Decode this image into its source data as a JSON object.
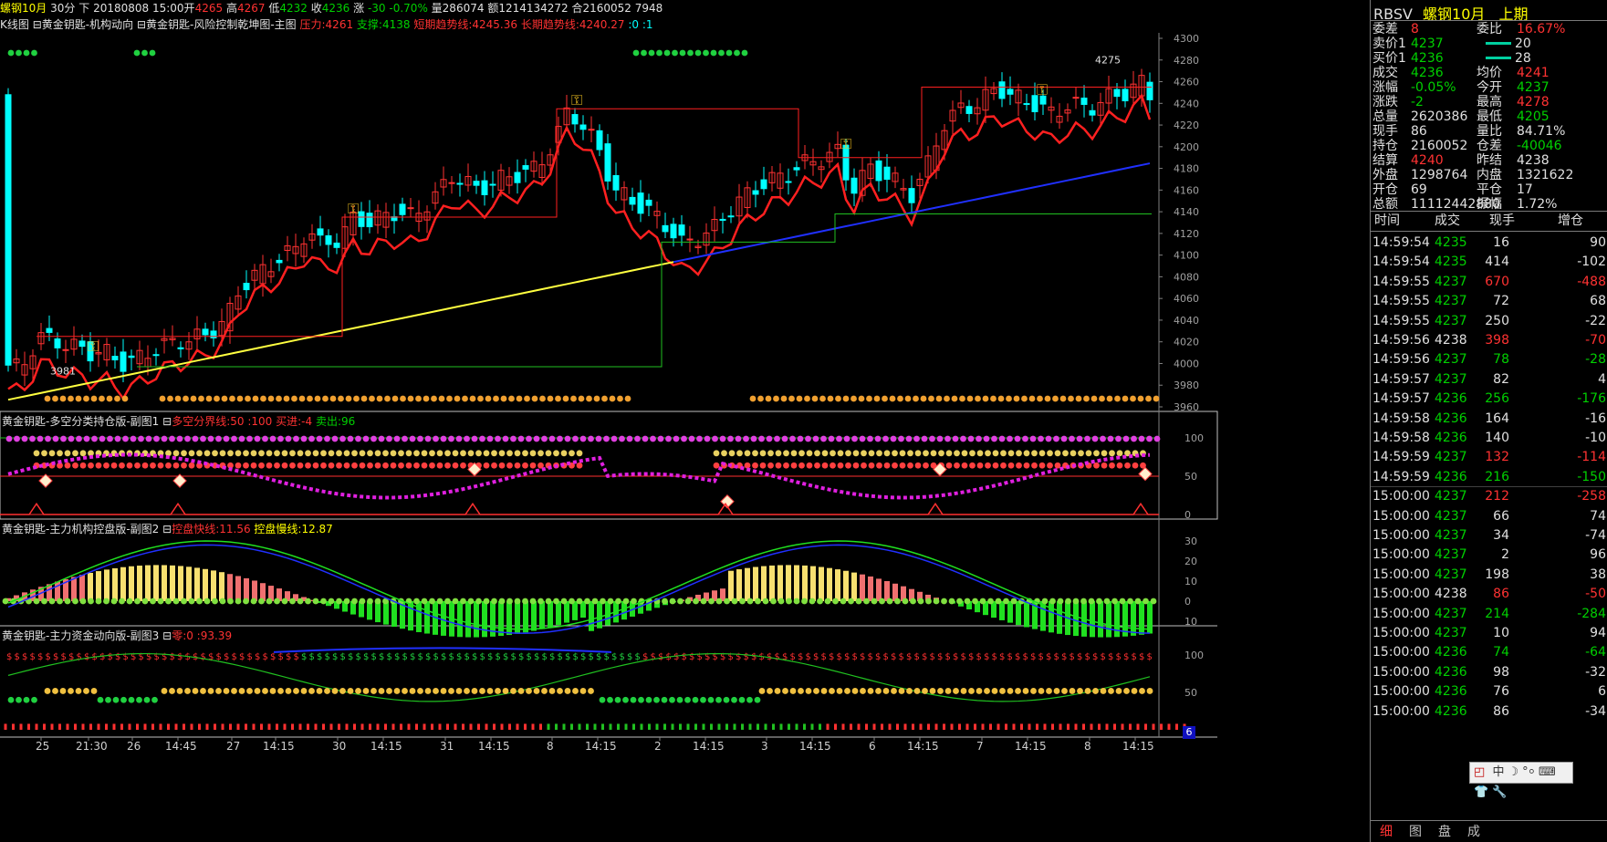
{
  "header": {
    "symbol": "螺钢10月",
    "period": "30分",
    "direction": "下",
    "date": "20180808 15:00",
    "open_label": "开",
    "open": "4265",
    "high_label": "高",
    "high": "4267",
    "low_label": "低",
    "low": "4232",
    "close_label": "收",
    "close": "4236",
    "change_label": "涨",
    "change": "-30",
    "change_pct": "-0.70%",
    "volume": "量286074",
    "amount": "额1214134272",
    "position": "合2160052 7948"
  },
  "main_pane": {
    "indicator_prefix": "K线图",
    "indicator1": "黄金钥匙-机构动向",
    "indicator2": "黄金钥匙-风险控制乾坤图-主图",
    "pressure": "压力:4261",
    "support": "支撑:4138",
    "short_trend": "短期趋势线:4245.36",
    "long_trend": "长期趋势线:4240.27",
    "extra": ":0 :1",
    "marker_3981": "3981",
    "marker_4275": "4275",
    "y_ticks": [
      "4300",
      "4280",
      "4260",
      "4240",
      "4220",
      "4200",
      "4180",
      "4160",
      "4140",
      "4120",
      "4100",
      "4080",
      "4060",
      "4040",
      "4020",
      "4000",
      "3980",
      "3960"
    ]
  },
  "sub1": {
    "title": "黄金钥匙-多空分类持仓版-副图1",
    "line1": "多空分界线:50 :100",
    "buy": "买进:-4",
    "sell": "卖出:96",
    "y_ticks": [
      "100",
      "50",
      "0"
    ]
  },
  "sub2": {
    "title": "黄金钥匙-主力机构控盘版-副图2",
    "fast": "控盘快线:11.56",
    "slow": "控盘慢线:12.87",
    "y_ticks": [
      "30",
      "20",
      "10",
      "0",
      "10"
    ]
  },
  "sub3": {
    "title": "黄金钥匙-主力资金动向版-副图3",
    "vals": "零:0 :93.39",
    "y_ticks": [
      "100",
      "50"
    ],
    "page_num": "6"
  },
  "x_axis": [
    "25",
    "21:30",
    "26",
    "14:45",
    "27",
    "14:15",
    "30",
    "14:15",
    "31",
    "14:15",
    "8",
    "14:15",
    "2",
    "14:15",
    "3",
    "14:15",
    "6",
    "14:15",
    "7",
    "14:15",
    "8",
    "14:15"
  ],
  "quote": {
    "code": "RBSV",
    "name": "螺钢10月",
    "status": "上期",
    "rows": [
      {
        "l1": "委差",
        "v1": "8",
        "c1": "red",
        "l2": "委比",
        "v2": "16.67%",
        "c2": "red"
      },
      {
        "l1": "卖价1",
        "v1": "4237",
        "c1": "green",
        "l2": "",
        "v2": "20",
        "c2": "white",
        "bar": "sell"
      },
      {
        "l1": "买价1",
        "v1": "4236",
        "c1": "green",
        "l2": "",
        "v2": "28",
        "c2": "white",
        "bar": "buy"
      },
      {
        "l1": "成交",
        "v1": "4236",
        "c1": "green",
        "l2": "均价",
        "v2": "4241",
        "c2": "red"
      },
      {
        "l1": "涨幅",
        "v1": "-0.05%",
        "c1": "green",
        "l2": "今开",
        "v2": "4237",
        "c2": "green"
      },
      {
        "l1": "涨跌",
        "v1": "-2",
        "c1": "green",
        "l2": "最高",
        "v2": "4278",
        "c2": "red"
      },
      {
        "l1": "总量",
        "v1": "2620386",
        "c1": "white",
        "l2": "最低",
        "v2": "4205",
        "c2": "green"
      },
      {
        "l1": "现手",
        "v1": "86",
        "c1": "white",
        "l2": "量比",
        "v2": "84.71%",
        "c2": "white"
      },
      {
        "l1": "持仓",
        "v1": "2160052",
        "c1": "white",
        "l2": "仓差",
        "v2": "-40046",
        "c2": "green"
      },
      {
        "l1": "结算",
        "v1": "4240",
        "c1": "red",
        "l2": "昨结",
        "v2": "4238",
        "c2": "white"
      },
      {
        "l1": "外盘",
        "v1": "1298764",
        "c1": "white",
        "l2": "内盘",
        "v2": "1321622",
        "c2": "white"
      },
      {
        "l1": "开仓",
        "v1": "69",
        "c1": "white",
        "l2": "平仓",
        "v2": "17",
        "c2": "white"
      },
      {
        "l1": "总额",
        "v1": "11112442880",
        "c1": "white",
        "l2": "振幅",
        "v2": "1.72%",
        "c2": "white"
      }
    ],
    "ticks_header": {
      "time": "时间",
      "price": "成交",
      "hand": "现手",
      "diff": "增仓"
    },
    "ticks": [
      {
        "t": "14:59:54",
        "p": "4235",
        "pc": "green",
        "h": "16",
        "hc": "white",
        "d": "90",
        "dc": "white"
      },
      {
        "t": "14:59:54",
        "p": "4235",
        "pc": "green",
        "h": "414",
        "hc": "white",
        "d": "-102",
        "dc": "white"
      },
      {
        "t": "14:59:55",
        "p": "4237",
        "pc": "green",
        "h": "670",
        "hc": "red",
        "d": "-488",
        "dc": "red"
      },
      {
        "t": "14:59:55",
        "p": "4237",
        "pc": "green",
        "h": "72",
        "hc": "white",
        "d": "68",
        "dc": "white"
      },
      {
        "t": "14:59:55",
        "p": "4237",
        "pc": "green",
        "h": "250",
        "hc": "white",
        "d": "-22",
        "dc": "white"
      },
      {
        "t": "14:59:56",
        "p": "4238",
        "pc": "white",
        "h": "398",
        "hc": "red",
        "d": "-70",
        "dc": "red"
      },
      {
        "t": "14:59:56",
        "p": "4237",
        "pc": "green",
        "h": "78",
        "hc": "green",
        "d": "-28",
        "dc": "green"
      },
      {
        "t": "14:59:57",
        "p": "4237",
        "pc": "green",
        "h": "82",
        "hc": "white",
        "d": "4",
        "dc": "white"
      },
      {
        "t": "14:59:57",
        "p": "4236",
        "pc": "green",
        "h": "256",
        "hc": "green",
        "d": "-176",
        "dc": "green"
      },
      {
        "t": "14:59:58",
        "p": "4236",
        "pc": "green",
        "h": "164",
        "hc": "white",
        "d": "-16",
        "dc": "white"
      },
      {
        "t": "14:59:58",
        "p": "4236",
        "pc": "green",
        "h": "140",
        "hc": "white",
        "d": "-10",
        "dc": "white"
      },
      {
        "t": "14:59:59",
        "p": "4237",
        "pc": "green",
        "h": "132",
        "hc": "red",
        "d": "-114",
        "dc": "red"
      },
      {
        "t": "14:59:59",
        "p": "4236",
        "pc": "green",
        "h": "216",
        "hc": "green",
        "d": "-150",
        "dc": "green"
      },
      {
        "t": "15:00:00",
        "p": "4237",
        "pc": "green",
        "h": "212",
        "hc": "red",
        "d": "-258",
        "dc": "red"
      },
      {
        "t": "15:00:00",
        "p": "4237",
        "pc": "green",
        "h": "66",
        "hc": "white",
        "d": "74",
        "dc": "white"
      },
      {
        "t": "15:00:00",
        "p": "4237",
        "pc": "green",
        "h": "34",
        "hc": "white",
        "d": "-74",
        "dc": "white"
      },
      {
        "t": "15:00:00",
        "p": "4237",
        "pc": "green",
        "h": "2",
        "hc": "white",
        "d": "96",
        "dc": "white"
      },
      {
        "t": "15:00:00",
        "p": "4237",
        "pc": "green",
        "h": "198",
        "hc": "white",
        "d": "38",
        "dc": "white"
      },
      {
        "t": "15:00:00",
        "p": "4238",
        "pc": "white",
        "h": "86",
        "hc": "red",
        "d": "-50",
        "dc": "red"
      },
      {
        "t": "15:00:00",
        "p": "4237",
        "pc": "green",
        "h": "214",
        "hc": "green",
        "d": "-284",
        "dc": "green"
      },
      {
        "t": "15:00:00",
        "p": "4237",
        "pc": "green",
        "h": "10",
        "hc": "white",
        "d": "94",
        "dc": "white"
      },
      {
        "t": "15:00:00",
        "p": "4236",
        "pc": "green",
        "h": "74",
        "hc": "green",
        "d": "-64",
        "dc": "green"
      },
      {
        "t": "15:00:00",
        "p": "4236",
        "pc": "green",
        "h": "98",
        "hc": "white",
        "d": "-32",
        "dc": "white"
      },
      {
        "t": "15:00:00",
        "p": "4236",
        "pc": "green",
        "h": "76",
        "hc": "white",
        "d": "6",
        "dc": "white"
      },
      {
        "t": "15:00:00",
        "p": "4236",
        "pc": "green",
        "h": "86",
        "hc": "white",
        "d": "-34",
        "dc": "white"
      }
    ],
    "tabs": [
      "细",
      "图",
      "盘",
      "成"
    ],
    "ime": {
      "items": [
        "中",
        "☽",
        "°⸰",
        "⌨",
        "👕",
        "🔧"
      ]
    }
  },
  "colors": {
    "up": "#ff3232",
    "down": "#00ffff",
    "bg": "#000000",
    "ma_yellow": "#ffff40",
    "ma_blue": "#2030ff",
    "trend_red": "#ff2020",
    "green": "#00d000"
  }
}
